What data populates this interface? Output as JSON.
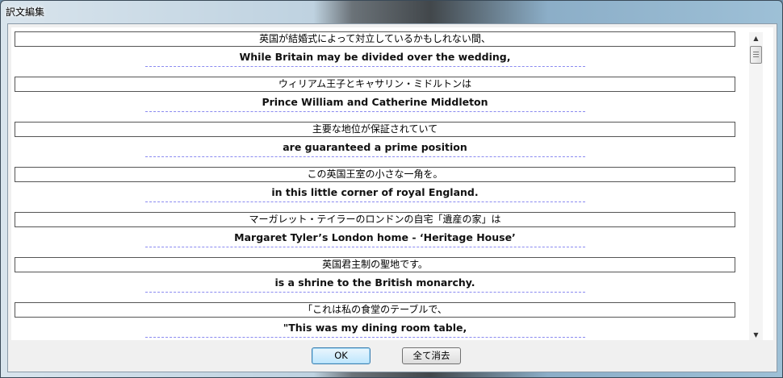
{
  "window": {
    "title": "訳文編集"
  },
  "entries": [
    {
      "source": "英国が結婚式によって対立しているかもしれない間、",
      "target": "While Britain may be divided over the wedding,"
    },
    {
      "source": "ウィリアム王子とキャサリン・ミドルトンは",
      "target": "Prince William and Catherine Middleton"
    },
    {
      "source": "主要な地位が保証されていて",
      "target": "are guaranteed a prime position"
    },
    {
      "source": "この英国王室の小さな一角を。",
      "target": "in this little corner of royal England."
    },
    {
      "source": "マーガレット・テイラーのロンドンの自宅「遺産の家」は",
      "target": "Margaret Tyler’s London home - ‘Heritage House’"
    },
    {
      "source": "英国君主制の聖地です。",
      "target": "is a shrine to the British monarchy."
    },
    {
      "source": "「これは私の食堂のテーブルで、",
      "target": "\"This was my dining room table,"
    }
  ],
  "buttons": {
    "ok_label": "OK",
    "clear_all_label": "全て消去"
  },
  "scrollbar": {
    "up_arrow": "▲",
    "down_arrow": "▼"
  }
}
